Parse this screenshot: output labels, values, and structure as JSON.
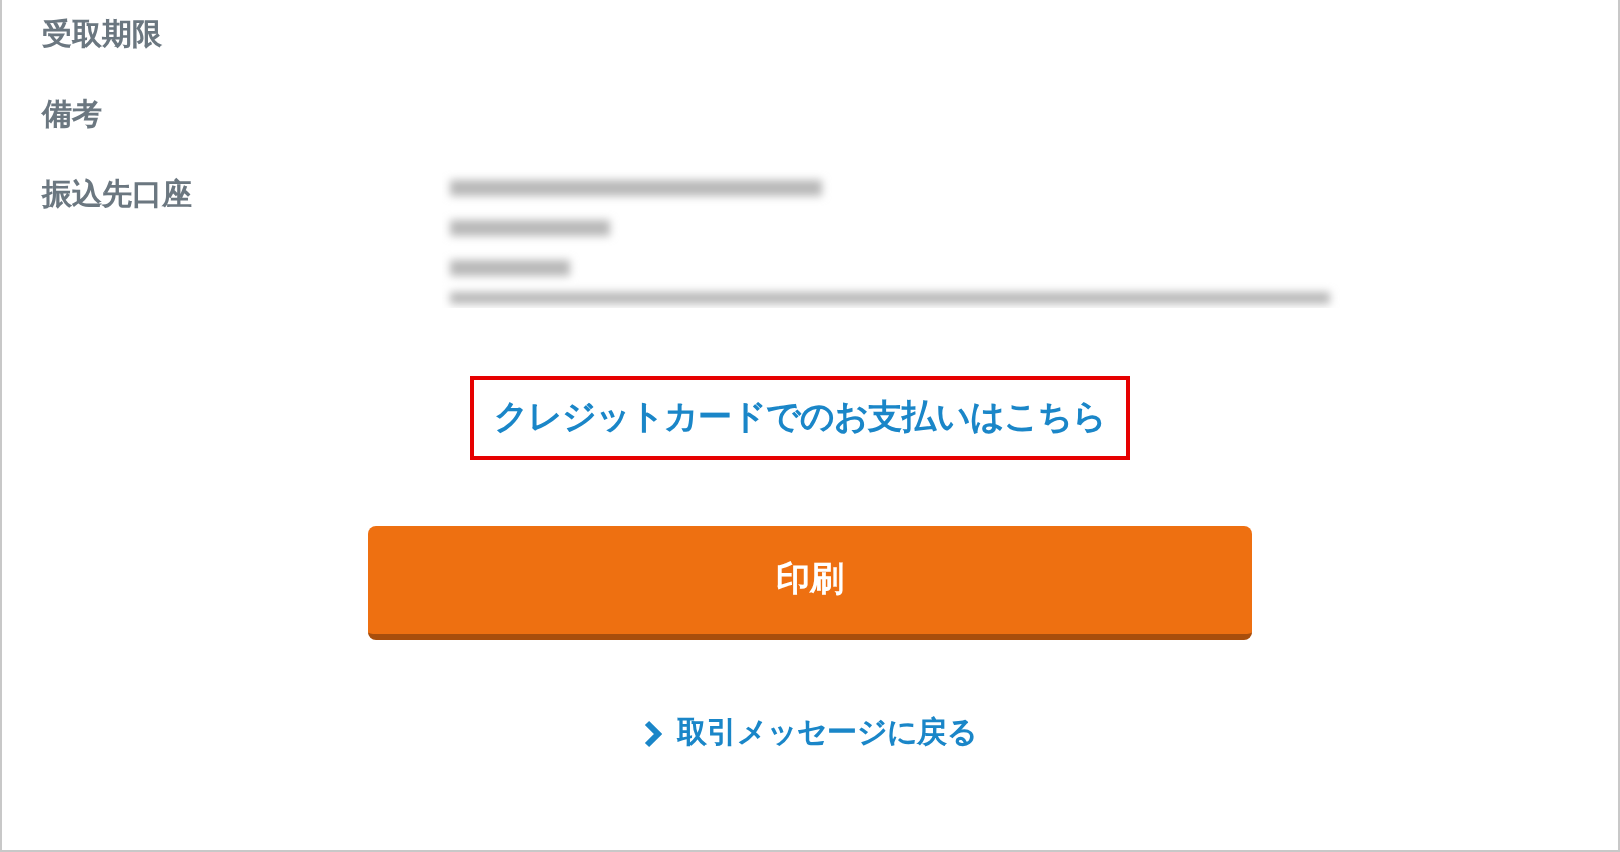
{
  "fields": [
    {
      "label": "受取期限"
    },
    {
      "label": "備考"
    },
    {
      "label": "振込先口座",
      "kind": "blurred"
    }
  ],
  "credit_link": {
    "text": "クレジットカードでのお支払いはこちら",
    "highlighted": true
  },
  "print_button": {
    "label": "印刷"
  },
  "back_link": {
    "text": "取引メッセージに戻る"
  }
}
